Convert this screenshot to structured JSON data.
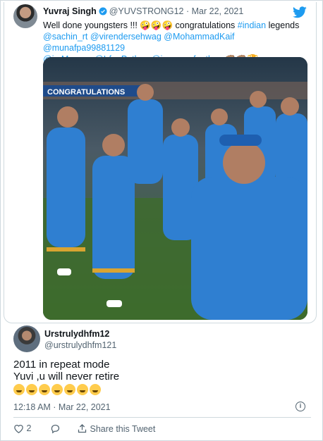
{
  "quoted_tweet": {
    "name": "Yuvraj Singh",
    "handle": "@YUVSTRONG12",
    "separator": "·",
    "date": "Mar 22, 2021",
    "text_lines": [
      "Well done youngsters !!! 🤪🤪🤪 congratulations ",
      "#indian",
      " legends",
      "@sachin_rt @virendersehwag @MohammadKaif @munafpa99881129",
      "@imMsgony @IrfanPathan @iamyusufpathan 👊🏽👊🏽🏆"
    ],
    "photo_banner": "CONGRATULATIONS",
    "photo_alt_colors": {
      "jersey": "#2f7fd1",
      "sky": "#1d2f3e",
      "grass": "#3d6b2c"
    }
  },
  "reply": {
    "name": "Urstrulydhfm12",
    "handle": "@urstrulydhfm121",
    "line1": "2011 in repeat mode",
    "line2": "Yuvi  ,u will never retire",
    "emoji_count": 7,
    "timestamp": "12:18 AM · Mar 22, 2021"
  },
  "actions": {
    "like_count": "2",
    "share_label": "Share this Tweet"
  },
  "colors": {
    "accent": "#1d9bf0",
    "muted": "#536471",
    "border": "#cfd9de"
  }
}
